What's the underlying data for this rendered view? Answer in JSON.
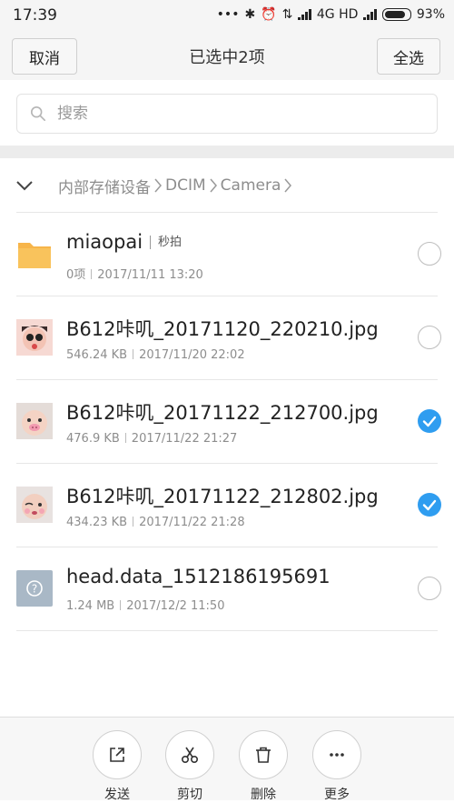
{
  "status_bar": {
    "time": "17:39",
    "network": "4G HD",
    "battery": "93%"
  },
  "header": {
    "cancel_label": "取消",
    "title": "已选中2项",
    "select_all_label": "全选"
  },
  "search": {
    "placeholder": "搜索"
  },
  "breadcrumb": {
    "items": [
      "内部存储设备",
      "DCIM",
      "Camera"
    ]
  },
  "files": [
    {
      "name": "miaopai",
      "tag": "秒拍",
      "size": "0项",
      "date": "2017/11/11 13:20",
      "type": "folder-icon",
      "selected": false
    },
    {
      "name": "B612咔叽_20171120_220210.jpg",
      "size": "546.24 KB",
      "date": "2017/11/20 22:02",
      "type": "image-thumbnail",
      "selected": false
    },
    {
      "name": "B612咔叽_20171122_212700.jpg",
      "size": "476.9 KB",
      "date": "2017/11/22 21:27",
      "type": "image-thumbnail",
      "selected": true
    },
    {
      "name": "B612咔叽_20171122_212802.jpg",
      "size": "434.23 KB",
      "date": "2017/11/22 21:28",
      "type": "image-thumbnail",
      "selected": true
    },
    {
      "name": "head.data_1512186195691",
      "size": "1.24 MB",
      "date": "2017/12/2 11:50",
      "type": "unknown-file-icon",
      "selected": false
    }
  ],
  "actions": [
    {
      "label": "发送",
      "icon": "share-icon"
    },
    {
      "label": "剪切",
      "icon": "scissors-icon"
    },
    {
      "label": "删除",
      "icon": "trash-icon"
    },
    {
      "label": "更多",
      "icon": "more-icon"
    }
  ],
  "colors": {
    "accent": "#2f9df0",
    "folder": "#f7b54a",
    "header_bg": "#f5f5f5"
  }
}
